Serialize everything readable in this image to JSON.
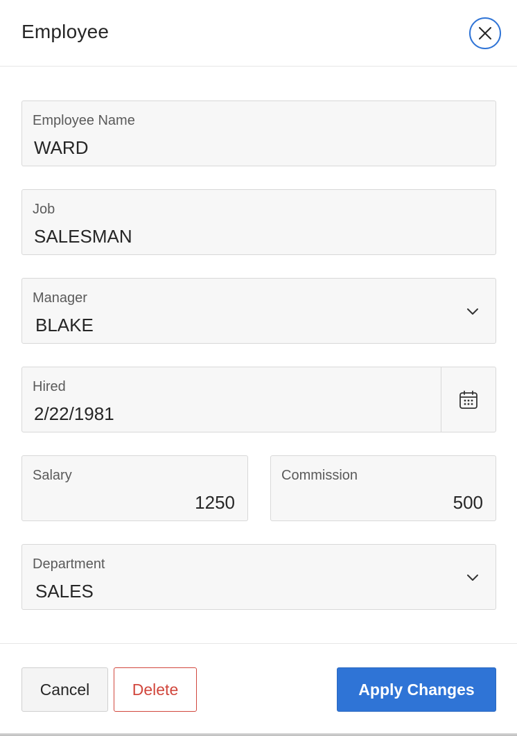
{
  "dialog": {
    "title": "Employee",
    "close_icon": "close-icon"
  },
  "fields": {
    "employee_name": {
      "label": "Employee Name",
      "value": "WARD"
    },
    "job": {
      "label": "Job",
      "value": "SALESMAN"
    },
    "manager": {
      "label": "Manager",
      "value": "BLAKE",
      "icon": "chevron-down-icon"
    },
    "hired": {
      "label": "Hired",
      "value": "2/22/1981",
      "icon": "calendar-icon"
    },
    "salary": {
      "label": "Salary",
      "value": "1250"
    },
    "commission": {
      "label": "Commission",
      "value": "500"
    },
    "department": {
      "label": "Department",
      "value": "SALES",
      "icon": "chevron-down-icon"
    }
  },
  "footer": {
    "cancel_label": "Cancel",
    "delete_label": "Delete",
    "apply_label": "Apply Changes"
  },
  "colors": {
    "primary": "#2f74d6",
    "danger": "#d1473d",
    "field_bg": "#f7f7f7",
    "field_border": "#d8d8d8"
  }
}
